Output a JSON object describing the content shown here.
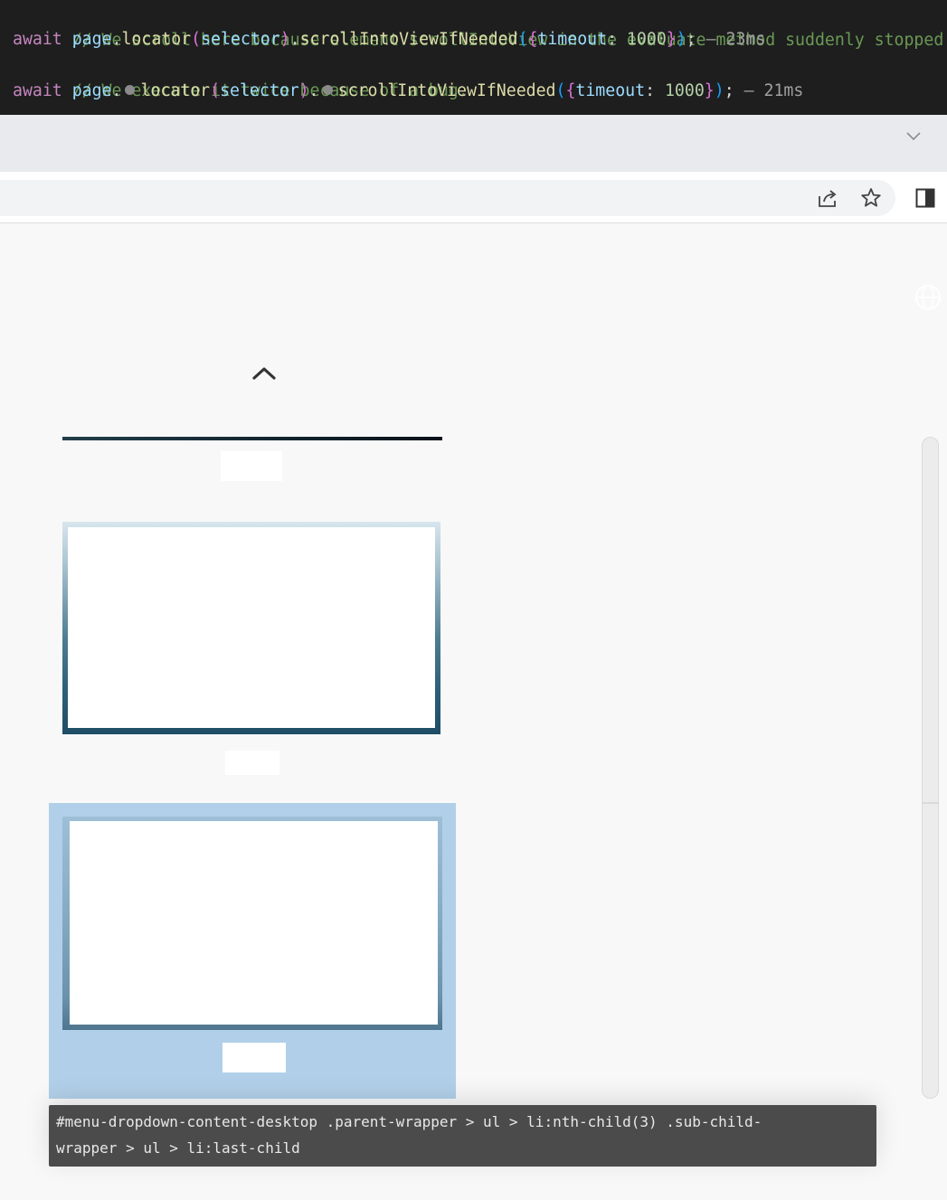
{
  "code_panel": {
    "line1": {
      "comment": "// We scroll here because element.scrollIntoView in the evaluate method suddenly stopped working"
    },
    "line2": {
      "kw": "await",
      "obj": "page",
      "dot": ".",
      "fn1": "locator",
      "paren_open": "(",
      "arg": "selector",
      "paren_close": ")",
      "fn2": "scrollIntoViewIfNeeded",
      "paren2_open": "(",
      "brace_open": "{",
      "prop": "timeout",
      "colon": ":",
      "num": "1000",
      "brace_close": "}",
      "paren2_close": ")",
      "semi": ";",
      "timing": "— 23ms"
    },
    "line3": {
      "comment": "// We execute it twice because of a bug."
    },
    "line4": {
      "kw": "await",
      "obj": "page",
      "dot": ".",
      "fn1": "locator",
      "paren_open": "(",
      "arg": "selector",
      "paren_close": ")",
      "fn2": "scrollIntoViewIfNeeded",
      "paren2_open": "(",
      "brace_open": "{",
      "prop": "timeout",
      "colon": ":",
      "num": "1000",
      "brace_close": "}",
      "paren2_close": ")",
      "semi": ";",
      "timing": "— 21ms"
    }
  },
  "browser": {
    "tab_strip_icon": "chevron-down-icon",
    "toolbar_icons": [
      "share-icon",
      "bookmark-star-icon",
      "side-panel-icon"
    ]
  },
  "page": {
    "icons": [
      "globe-icon",
      "chevron-up-icon"
    ],
    "highlight_color": "#b1cfe9"
  },
  "tooltip": {
    "selector_line1": "#menu-dropdown-content-desktop .parent-wrapper > ul > li:nth-child(3) .sub-child-",
    "selector_line2": "wrapper > ul > li:last-child"
  },
  "colors": {
    "code_bg": "#1e1e1e",
    "tab_strip": "#e9eaed",
    "tooltip_bg": "#4b4b4b"
  }
}
